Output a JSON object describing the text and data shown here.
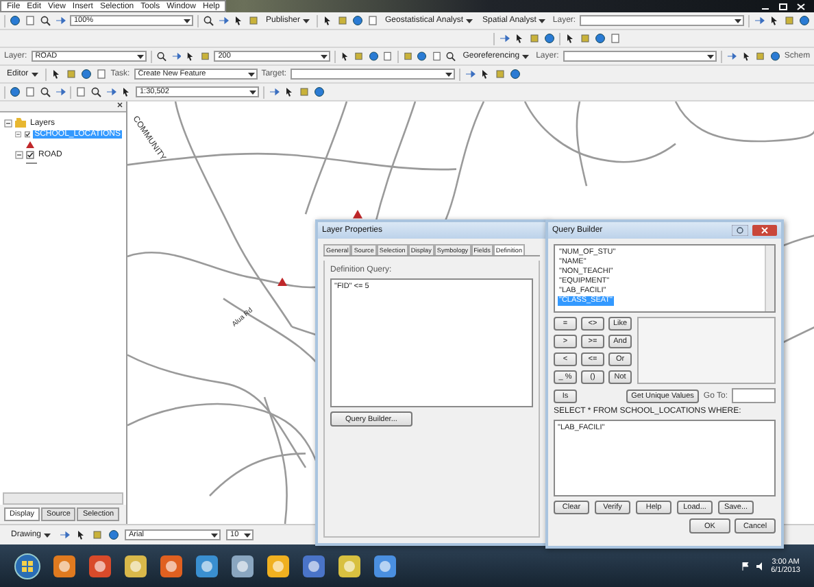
{
  "menu_bar": [
    "File",
    "Edit",
    "View",
    "Insert",
    "Selection",
    "Tools",
    "Window",
    "Help"
  ],
  "toolbars": [
    {
      "items": [
        {
          "kind": "icons"
        },
        {
          "kind": "combo",
          "value": "100%"
        },
        {
          "kind": "icons"
        },
        {
          "kind": "menu",
          "label": "Publisher"
        },
        {
          "kind": "icons"
        },
        {
          "kind": "menu",
          "label": "Geostatistical Analyst"
        },
        {
          "kind": "menu",
          "label": "Spatial Analyst"
        },
        {
          "kind": "label",
          "label": "Layer:"
        },
        {
          "kind": "combo"
        },
        {
          "kind": "icons"
        }
      ]
    },
    {
      "items": [
        {
          "kind": "icons"
        },
        {
          "kind": "icons"
        }
      ]
    },
    {
      "items": [
        {
          "kind": "label",
          "label": "Layer:"
        },
        {
          "kind": "combo",
          "value": "ROAD"
        },
        {
          "kind": "icons"
        },
        {
          "kind": "combo",
          "value": "200"
        },
        {
          "kind": "icons"
        },
        {
          "kind": "icons"
        },
        {
          "kind": "menu",
          "label": "Georeferencing"
        },
        {
          "kind": "label",
          "label": "Layer:"
        },
        {
          "kind": "combo"
        },
        {
          "kind": "icons"
        },
        {
          "kind": "label",
          "label": "Schem"
        }
      ]
    },
    {
      "items": [
        {
          "kind": "menu",
          "label": "Editor"
        },
        {
          "kind": "icons"
        },
        {
          "kind": "label",
          "label": "Task:"
        },
        {
          "kind": "combo",
          "value": "Create New Feature"
        },
        {
          "kind": "label",
          "label": "Target:"
        },
        {
          "kind": "combo"
        },
        {
          "kind": "icons"
        }
      ]
    },
    {
      "items": [
        {
          "kind": "icons"
        },
        {
          "kind": "icons"
        },
        {
          "kind": "combo",
          "value": "1:30,502"
        },
        {
          "kind": "icons"
        }
      ]
    }
  ],
  "toc": {
    "label": "Layers",
    "expanded": true,
    "children": [
      {
        "label": "SCHOOL_LOCATIONS",
        "checked": true,
        "selected": true,
        "expanded": true,
        "kind": "point"
      },
      {
        "label": "ROAD",
        "checked": true,
        "selected": false,
        "expanded": true,
        "kind": "line"
      }
    ]
  },
  "toc_tabs": [
    {
      "label": "Display",
      "selected": true
    },
    {
      "label": "Source",
      "selected": false
    },
    {
      "label": "Selection",
      "selected": false
    }
  ],
  "map_labels": [
    "COMMUNITY",
    "Alua Rd"
  ],
  "drawing_toolbar": {
    "menu": "Drawing",
    "font": "Arial",
    "size": "10"
  },
  "layer_properties": {
    "title": "Layer Properties",
    "tabs": [
      {
        "label": "General",
        "selected": false
      },
      {
        "label": "Source",
        "selected": false
      },
      {
        "label": "Selection",
        "selected": false
      },
      {
        "label": "Display",
        "selected": false
      },
      {
        "label": "Symbology",
        "selected": false
      },
      {
        "label": "Fields",
        "selected": false
      },
      {
        "label": "Definition",
        "selected": true
      }
    ],
    "query_label": "Definition Query:",
    "query": "\"FID\" <= 5",
    "button": "Query Builder..."
  },
  "query_builder": {
    "title": "Query Builder",
    "fields": [
      {
        "label": "\"NUM_OF_STU\"",
        "selected": false
      },
      {
        "label": "\"NAME\"",
        "selected": false
      },
      {
        "label": "\"NON_TEACHI\"",
        "selected": false
      },
      {
        "label": "\"EQUIPMENT\"",
        "selected": false
      },
      {
        "label": "\"LAB_FACILI\"",
        "selected": false
      },
      {
        "label": "\"CLASS_SEAT\"",
        "selected": true
      }
    ],
    "operators": [
      "=",
      "<>",
      "Like",
      ">",
      ">=",
      "And",
      "<",
      "<=",
      "Or",
      "_ %",
      "()",
      "Not"
    ],
    "is_button": "Is",
    "unique_button": "Get Unique Values",
    "goto_label": "Go To:",
    "select_label": "SELECT * FROM SCHOOL_LOCATIONS WHERE:",
    "expression": "\"LAB_FACILI\"",
    "buttons": [
      "Clear",
      "Verify",
      "Help",
      "Load...",
      "Save..."
    ],
    "ok": "OK",
    "cancel": "Cancel"
  },
  "taskbar": {
    "time": "3:00 AM",
    "date": "6/1/2013"
  }
}
